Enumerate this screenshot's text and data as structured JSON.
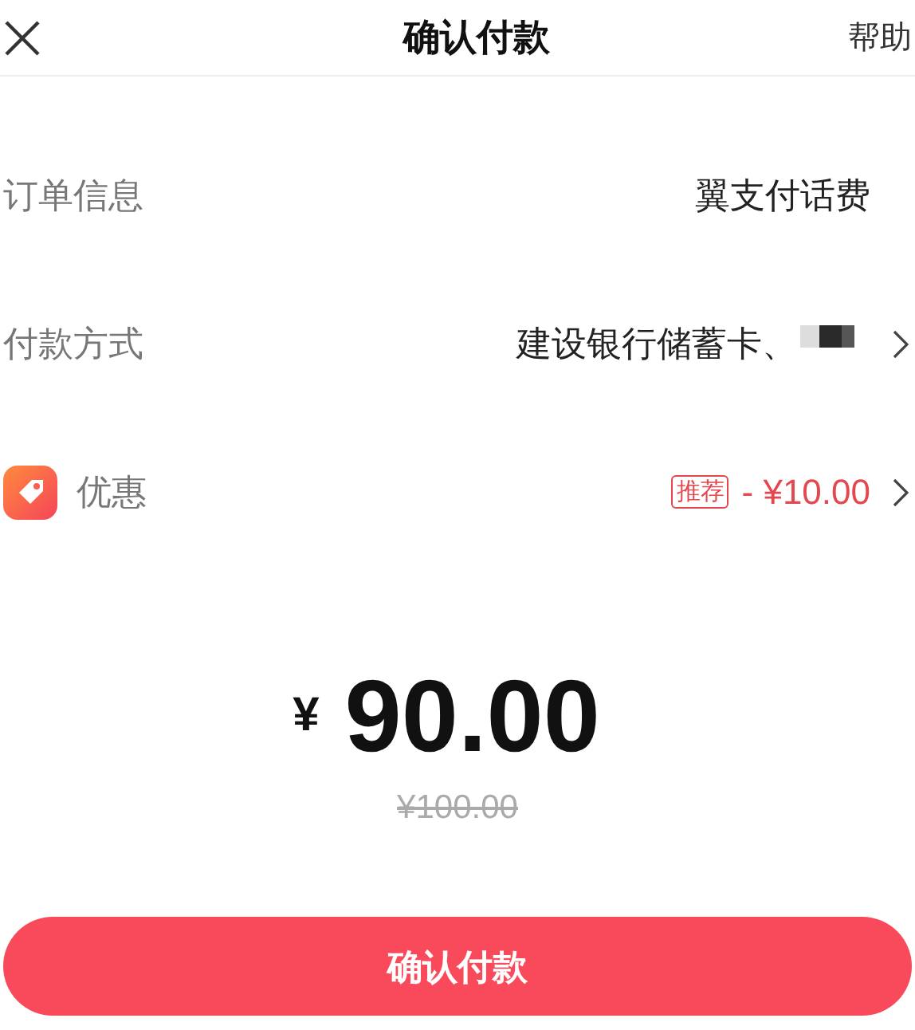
{
  "header": {
    "title": "确认付款",
    "help": "帮助"
  },
  "rows": [
    {
      "kind": "text",
      "label": "订单信息",
      "value": "翼支付话费"
    },
    {
      "kind": "method",
      "label": "付款方式",
      "value": "建设银行储蓄卡、"
    },
    {
      "kind": "discount",
      "label": "优惠",
      "tag": "推荐",
      "value": "- ¥10.00"
    }
  ],
  "amount": {
    "currency": "¥",
    "value": "90.00",
    "original": "¥100.00"
  },
  "confirm_button": "确认付款"
}
